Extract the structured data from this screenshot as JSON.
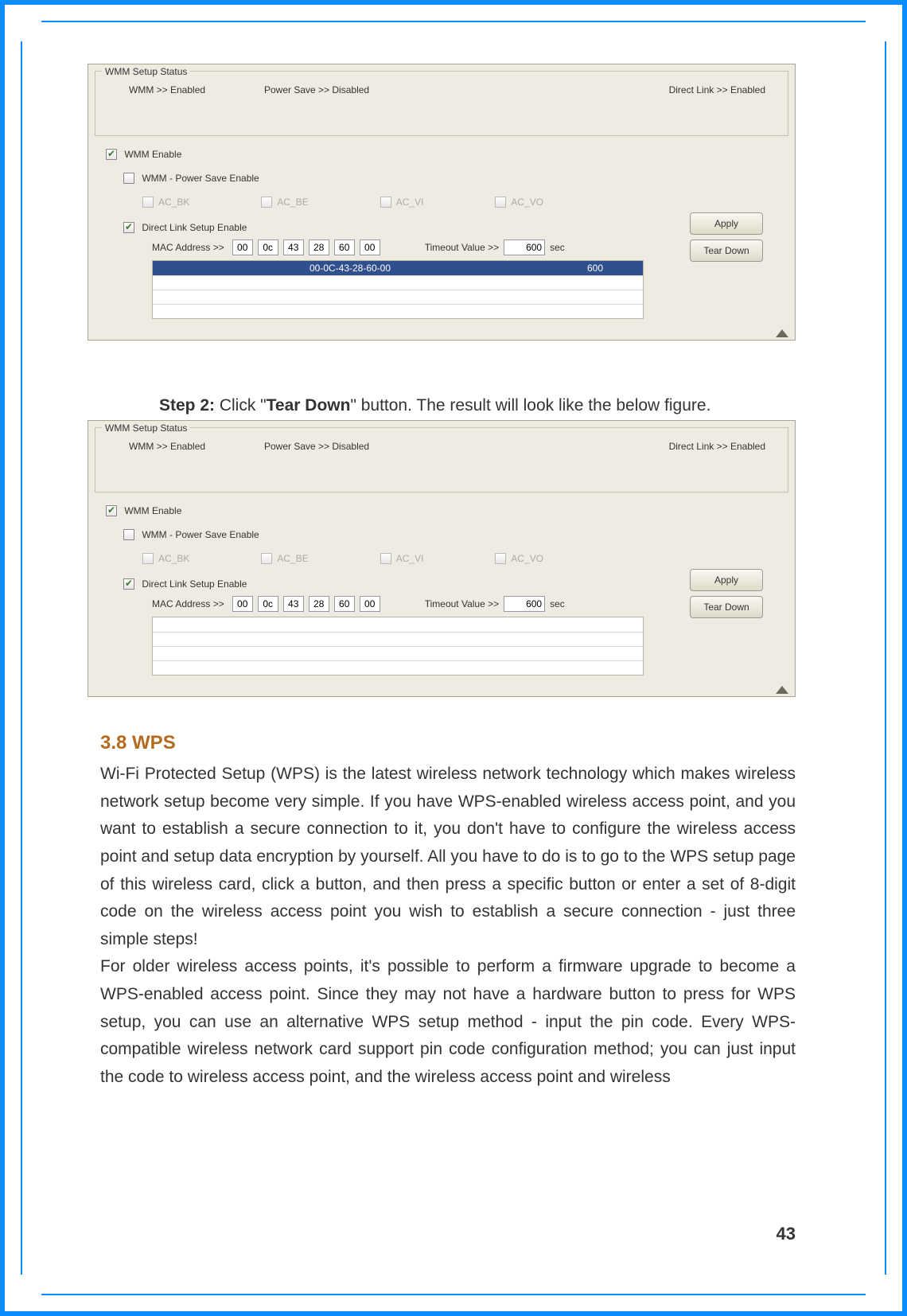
{
  "panel1": {
    "legend": "WMM Setup Status",
    "status": {
      "wmm": "WMM >> Enabled",
      "power_save": "Power Save >> Disabled",
      "direct_link": "Direct Link >> Enabled"
    },
    "wmm_enable": "WMM Enable",
    "wmm_ps": "WMM - Power Save Enable",
    "ac": {
      "bk": "AC_BK",
      "be": "AC_BE",
      "vi": "AC_VI",
      "vo": "AC_VO"
    },
    "dls": "Direct Link Setup Enable",
    "mac_label": "MAC Address >>",
    "mac": [
      "00",
      "0c",
      "43",
      "28",
      "60",
      "00"
    ],
    "timeout_label": "Timeout Value >>",
    "timeout_value": "600",
    "timeout_unit": "sec",
    "table": {
      "mac": "00-0C-43-28-60-00",
      "timeout": "600"
    },
    "apply": "Apply",
    "tear_down": "Tear Down"
  },
  "step2_prefix": "Step 2:",
  "step2_mid1": " Click \"",
  "step2_bold": "Tear Down",
  "step2_mid2": "\" button. The result will look like the below figure.",
  "panel2": {
    "legend": "WMM Setup Status",
    "status": {
      "wmm": "WMM >> Enabled",
      "power_save": "Power Save >> Disabled",
      "direct_link": "Direct Link >> Enabled"
    },
    "wmm_enable": "WMM Enable",
    "wmm_ps": "WMM - Power Save Enable",
    "ac": {
      "bk": "AC_BK",
      "be": "AC_BE",
      "vi": "AC_VI",
      "vo": "AC_VO"
    },
    "dls": "Direct Link Setup Enable",
    "mac_label": "MAC Address >>",
    "mac": [
      "00",
      "0c",
      "43",
      "28",
      "60",
      "00"
    ],
    "timeout_label": "Timeout Value >>",
    "timeout_value": "600",
    "timeout_unit": "sec",
    "apply": "Apply",
    "tear_down": "Tear Down"
  },
  "section_heading": "3.8 WPS",
  "body1": "Wi-Fi Protected Setup (WPS) is the latest wireless network technology which makes wireless network setup become very simple. If you have WPS-enabled wireless access point, and you want to establish a secure connection to it, you don't have to configure the wireless access point and setup data encryption by yourself. All you have to do is to go to the WPS setup page of this wireless card, click a button, and then press a specific button or enter a set of 8-digit code on the wireless access point you wish to establish a secure connection - just three simple steps!",
  "body2": "For older wireless access points, it's possible to perform a firmware upgrade to become a WPS-enabled access point. Since they may not have a hardware button to press for WPS setup, you can use an alternative WPS setup method - input the pin code. Every WPS-compatible wireless network card support pin code configuration method; you can just input the code to wireless access point, and the wireless access point and wireless",
  "page_number": "43"
}
